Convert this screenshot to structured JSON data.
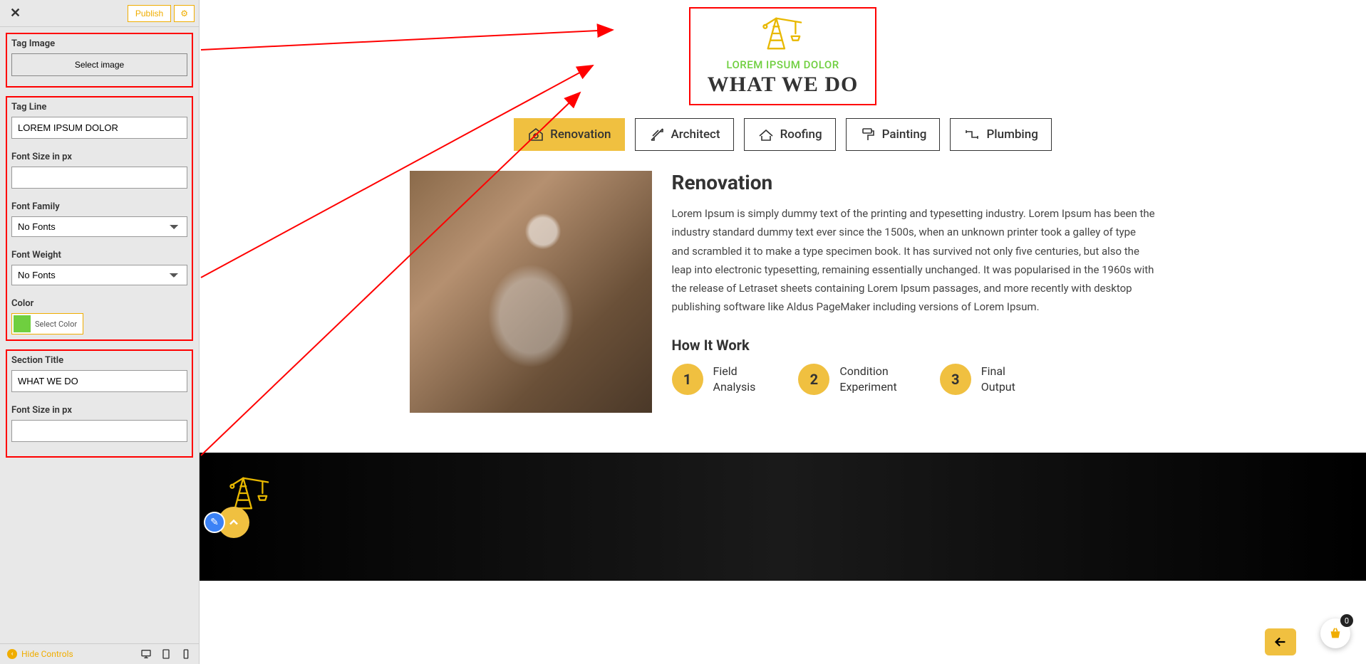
{
  "sidebar": {
    "publish_label": "Publish",
    "tag_image": {
      "label": "Tag Image",
      "button": "Select image"
    },
    "tag_line": {
      "label": "Tag Line",
      "value": "LOREM IPSUM DOLOR",
      "font_size_label": "Font Size in px",
      "font_size_value": "",
      "font_family_label": "Font Family",
      "font_family_value": "No Fonts",
      "font_weight_label": "Font Weight",
      "font_weight_value": "No Fonts",
      "color_label": "Color",
      "color_button": "Select Color",
      "color_hex": "#6fcf3f"
    },
    "section_title": {
      "label": "Section Title",
      "value": "WHAT WE DO",
      "font_size_label": "Font Size in px",
      "font_size_value": ""
    },
    "footer": {
      "hide_controls": "Hide Controls"
    }
  },
  "preview": {
    "tag_line": "LOREM IPSUM DOLOR",
    "section_title": "WHAT WE DO",
    "tabs": [
      {
        "label": "Renovation",
        "active": true
      },
      {
        "label": "Architect",
        "active": false
      },
      {
        "label": "Roofing",
        "active": false
      },
      {
        "label": "Painting",
        "active": false
      },
      {
        "label": "Plumbing",
        "active": false
      }
    ],
    "content": {
      "heading": "Renovation",
      "paragraph": "Lorem Ipsum is simply dummy text of the printing and typesetting industry. Lorem Ipsum has been the industry standard dummy text ever since the 1500s, when an unknown printer took a galley of type and scrambled it to make a type specimen book. It has survived not only five centuries, but also the leap into electronic typesetting, remaining essentially unchanged. It was popularised in the 1960s with the release of Letraset sheets containing Lorem Ipsum passages, and more recently with desktop publishing software like Aldus PageMaker including versions of Lorem Ipsum.",
      "how_title": "How It Work",
      "steps": [
        {
          "num": "1",
          "text_a": "Field",
          "text_b": "Analysis"
        },
        {
          "num": "2",
          "text_a": "Condition",
          "text_b": "Experiment"
        },
        {
          "num": "3",
          "text_a": "Final",
          "text_b": "Output"
        }
      ]
    }
  },
  "cart": {
    "badge": "0"
  },
  "colors": {
    "accent": "#f0c040",
    "tagline": "#6fcf3f",
    "highlight": "#ff0000"
  }
}
